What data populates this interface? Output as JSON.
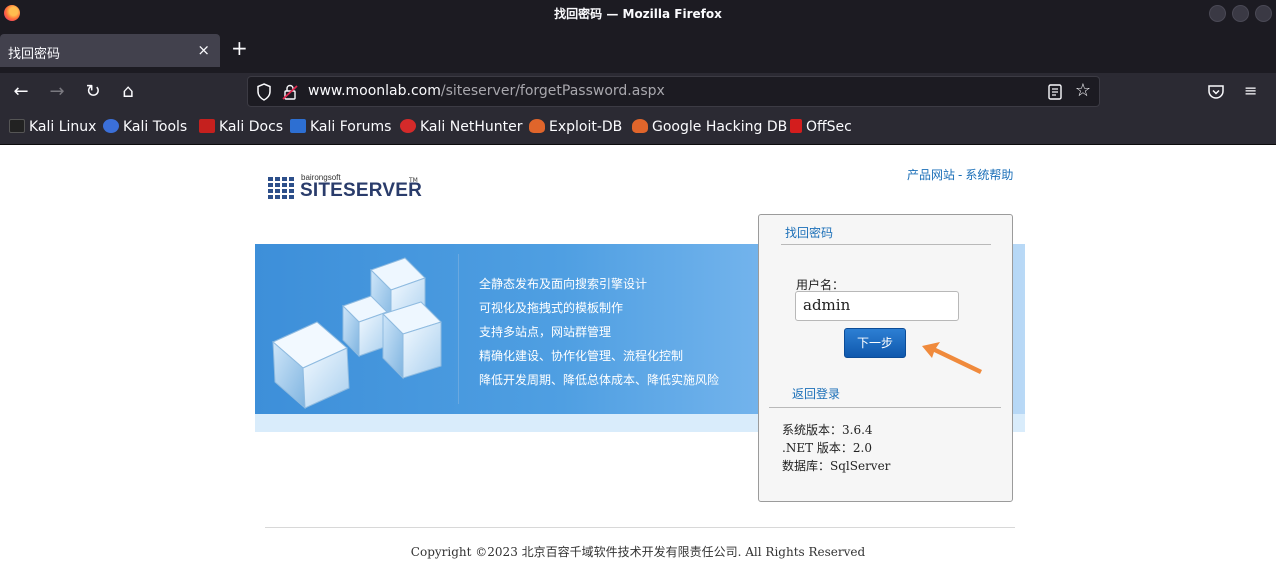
{
  "window": {
    "title": "找回密码 — Mozilla Firefox"
  },
  "tab": {
    "title": "找回密码",
    "close": "×",
    "new_tab": "+"
  },
  "nav": {
    "back": "←",
    "forward": "→",
    "reload": "↻",
    "home": "⌂",
    "url_host": "www.moonlab.com",
    "url_path": "/siteserver/forgetPassword.aspx",
    "bookmark_star": "☆",
    "menu": "≡"
  },
  "bookmarks": [
    {
      "label": "Kali Linux",
      "color": "#222222"
    },
    {
      "label": "Kali Tools",
      "color": "#3b6fd8"
    },
    {
      "label": "Kali Docs",
      "color": "#c5201e"
    },
    {
      "label": "Kali Forums",
      "color": "#2d6fd2"
    },
    {
      "label": "Kali NetHunter",
      "color": "#d42a2a"
    },
    {
      "label": "Exploit-DB",
      "color": "#e0652b"
    },
    {
      "label": "Google Hacking DB",
      "color": "#e0652b"
    },
    {
      "label": "OffSec",
      "color": "#d31d1d"
    }
  ],
  "site": {
    "logo_company": "bairongsoft",
    "logo_brand": "SITESERVER",
    "logo_tm": "TM",
    "top_link_product": "产品网站",
    "top_link_sep": "-",
    "top_link_help": "系统帮助",
    "features": [
      "全静态发布及面向搜索引擎设计",
      "可视化及拖拽式的模板制作",
      "支持多站点，网站群管理",
      "精确化建设、协作化管理、流程化控制",
      "降低开发周期、降低总体成本、降低实施风险"
    ]
  },
  "panel": {
    "title": "找回密码",
    "username_label": "用户名：",
    "username_value": "admin",
    "next_button": "下一步",
    "back_link": "返回登录",
    "version": "系统版本：3.6.4",
    "net_version": ".NET 版本：2.0",
    "database": "数据库：SqlServer"
  },
  "footer": {
    "copyright": "Copyright ©2023 北京百容千域软件技术开发有限责任公司. All Rights Reserved"
  },
  "colors": {
    "link": "#1b6fb8",
    "chrome_dark": "#1c1b22",
    "chrome_mid": "#2b2a33",
    "annotation_arrow": "#f08a3c"
  }
}
